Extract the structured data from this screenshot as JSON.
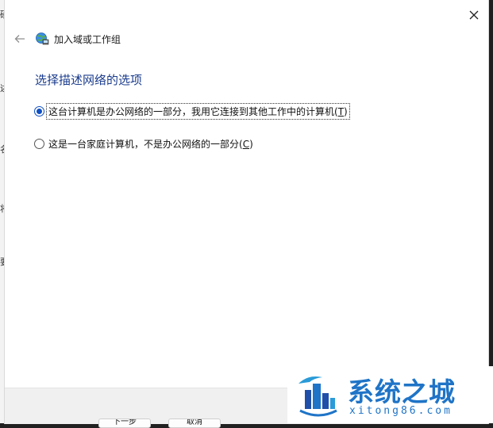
{
  "background": {
    "left_fragments": [
      "硬",
      "述",
      "名",
      "将",
      "要"
    ]
  },
  "dialog": {
    "title": "加入域或工作组",
    "heading": "选择描述网络的选项",
    "options": [
      {
        "prefix": "这台计算机是办公网络的一部分，我用它连接到其他工作中的计算机(",
        "key": "T",
        "suffix": ")",
        "selected": true
      },
      {
        "prefix": "这是一台家庭计算机，不是办公网络的一部分(",
        "key": "C",
        "suffix": ")",
        "selected": false
      }
    ],
    "footer_buttons": [
      "下一步",
      "取消"
    ]
  },
  "watermark": {
    "title": "系统之城",
    "url": "xitong86.com"
  },
  "colors": {
    "heading": "#1b3c8c",
    "radio_accent": "#0f4fc4",
    "watermark": "#1f74c7"
  }
}
